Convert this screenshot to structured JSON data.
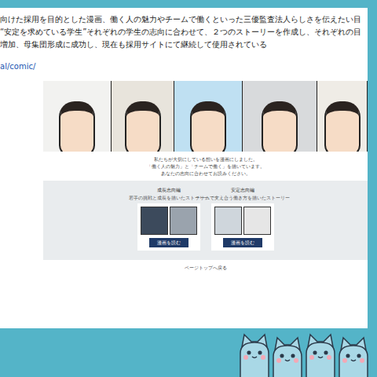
{
  "intro": {
    "lines": [
      "向けた採用を目的とした漫画、働く人の魅力やチームで働くといった三優監査法人らしさを伝えたい目",
      "“安定を求めている学生”それぞれの学生の志向に合わせて、２つのストーリーを作成し、それぞれの目",
      "増加、母集団形成に成功し、現在も採用サイトにて継続して使用されている"
    ],
    "link": "al/comic/"
  },
  "site": {
    "lead": [
      "私たちが大切にしている想いを漫画にしました。",
      "「働く人の魅力」と「チームで働く」を描いています。",
      "あなたの志向に合わせてお読みください。"
    ],
    "cards": [
      {
        "title": "成長志向編",
        "body": "若手の挑戦と成長を描いたストーリー",
        "button": "漫画を読む"
      },
      {
        "title": "安定志向編",
        "body": "チームで支え合う働き方を描いたストーリー",
        "button": "漫画を読む"
      }
    ],
    "footer": "ページトップへ戻る"
  }
}
